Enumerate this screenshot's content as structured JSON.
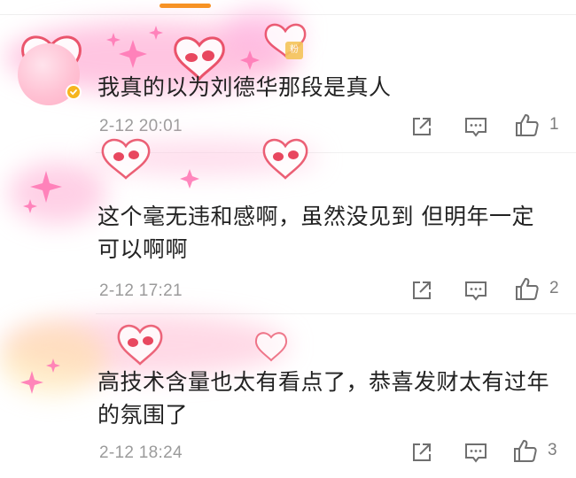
{
  "comments": [
    {
      "text": "我真的以为刘德华那段是真人",
      "time": "2-12 20:01",
      "likes": "1",
      "fan_tag": "粉"
    },
    {
      "text": "这个毫无违和感啊，虽然没见到 但明年一定可以啊啊",
      "time": "2-12 17:21",
      "likes": "2"
    },
    {
      "text": "高技术含量也太有看点了，恭喜发财太有过年的氛围了",
      "time": "2-12 18:24",
      "likes": "3"
    }
  ],
  "icons": {
    "share": "share-icon",
    "comment": "comment-icon",
    "like": "thumbs-up-icon",
    "verified": "verified-badge-icon"
  },
  "colors": {
    "accent": "#f7931e",
    "pendant_pink": "#ff8fc0",
    "heart_red": "#e8475f",
    "verified": "#f6b51e",
    "meta_gray": "#9b9b9b"
  }
}
